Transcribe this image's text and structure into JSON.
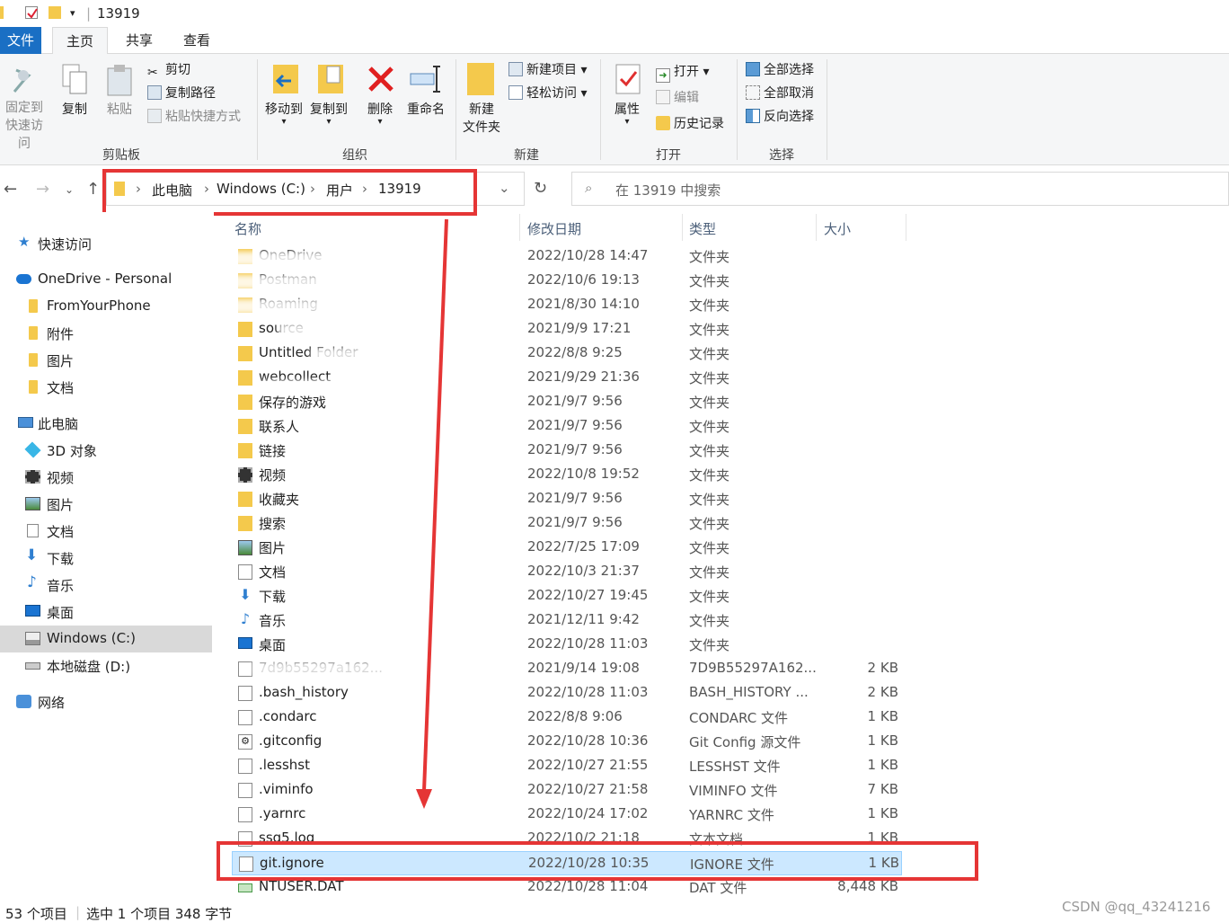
{
  "window": {
    "title": "13919"
  },
  "ribbon_tabs": [
    "文件",
    "主页",
    "共享",
    "查看"
  ],
  "ribbon": {
    "clipboard": {
      "label": "剪贴板",
      "pin": "固定到",
      "pin2": "快速访问",
      "copy": "复制",
      "paste": "粘贴",
      "cut": "剪切",
      "copy_path": "复制路径",
      "paste_shortcut": "粘贴快捷方式"
    },
    "organize": {
      "label": "组织",
      "move_to": "移动到",
      "copy_to": "复制到",
      "delete": "删除",
      "rename": "重命名"
    },
    "new": {
      "label": "新建",
      "new_folder": "新建",
      "new_folder2": "文件夹",
      "new_item": "新建项目",
      "easy_access": "轻松访问"
    },
    "open": {
      "label": "打开",
      "properties": "属性",
      "open": "打开",
      "edit": "编辑",
      "history": "历史记录"
    },
    "select": {
      "label": "选择",
      "select_all": "全部选择",
      "select_none": "全部取消",
      "invert": "反向选择"
    }
  },
  "address": {
    "crumbs": [
      "此电脑",
      "Windows (C:)",
      "用户",
      "13919"
    ],
    "search_placeholder": "在 13919 中搜索"
  },
  "sidebar": [
    {
      "label": "快速访问",
      "icon": "star-icon"
    },
    {
      "label": "OneDrive - Personal",
      "icon": "cloud-icon"
    },
    {
      "label": "FromYourPhone",
      "icon": "folder-icon"
    },
    {
      "label": "附件",
      "icon": "folder-icon"
    },
    {
      "label": "图片",
      "icon": "folder-icon"
    },
    {
      "label": "文档",
      "icon": "folder-icon"
    },
    {
      "label": "此电脑",
      "icon": "computer-icon"
    },
    {
      "label": "3D 对象",
      "icon": "cube-icon"
    },
    {
      "label": "视频",
      "icon": "film-icon"
    },
    {
      "label": "图片",
      "icon": "picture-icon"
    },
    {
      "label": "文档",
      "icon": "document-icon"
    },
    {
      "label": "下载",
      "icon": "download-icon"
    },
    {
      "label": "音乐",
      "icon": "music-icon"
    },
    {
      "label": "桌面",
      "icon": "desktop-icon"
    },
    {
      "label": "Windows (C:)",
      "icon": "drive-icon"
    },
    {
      "label": "本地磁盘 (D:)",
      "icon": "disk-icon"
    },
    {
      "label": "网络",
      "icon": "network-icon"
    }
  ],
  "columns": [
    "名称",
    "修改日期",
    "类型",
    "大小"
  ],
  "files": [
    {
      "name": "OneDrive",
      "date": "2022/10/28 14:47",
      "type": "文件夹",
      "size": "",
      "icon": "folder"
    },
    {
      "name": "Postman",
      "date": "2022/10/6 19:13",
      "type": "文件夹",
      "size": "",
      "icon": "folder"
    },
    {
      "name": "Roaming",
      "date": "2021/8/30 14:10",
      "type": "文件夹",
      "size": "",
      "icon": "folder"
    },
    {
      "name": "source",
      "date": "2021/9/9 17:21",
      "type": "文件夹",
      "size": "",
      "icon": "folder"
    },
    {
      "name": "Untitled Folder",
      "date": "2022/8/8 9:25",
      "type": "文件夹",
      "size": "",
      "icon": "folder"
    },
    {
      "name": "webcollect",
      "date": "2021/9/29 21:36",
      "type": "文件夹",
      "size": "",
      "icon": "folder"
    },
    {
      "name": "保存的游戏",
      "date": "2021/9/7 9:56",
      "type": "文件夹",
      "size": "",
      "icon": "folder"
    },
    {
      "name": "联系人",
      "date": "2021/9/7 9:56",
      "type": "文件夹",
      "size": "",
      "icon": "folder"
    },
    {
      "name": "链接",
      "date": "2021/9/7 9:56",
      "type": "文件夹",
      "size": "",
      "icon": "folder"
    },
    {
      "name": "视频",
      "date": "2022/10/8 19:52",
      "type": "文件夹",
      "size": "",
      "icon": "film"
    },
    {
      "name": "收藏夹",
      "date": "2021/9/7 9:56",
      "type": "文件夹",
      "size": "",
      "icon": "folder"
    },
    {
      "name": "搜索",
      "date": "2021/9/7 9:56",
      "type": "文件夹",
      "size": "",
      "icon": "folder"
    },
    {
      "name": "图片",
      "date": "2022/7/25 17:09",
      "type": "文件夹",
      "size": "",
      "icon": "picture"
    },
    {
      "name": "文档",
      "date": "2022/10/3 21:37",
      "type": "文件夹",
      "size": "",
      "icon": "document"
    },
    {
      "name": "下载",
      "date": "2022/10/27 19:45",
      "type": "文件夹",
      "size": "",
      "icon": "download"
    },
    {
      "name": "音乐",
      "date": "2021/12/11 9:42",
      "type": "文件夹",
      "size": "",
      "icon": "music"
    },
    {
      "name": "桌面",
      "date": "2022/10/28 11:03",
      "type": "文件夹",
      "size": "",
      "icon": "desktop"
    },
    {
      "name": "7d9b55297a162...",
      "date": "2021/9/14 19:08",
      "type": "7D9B55297A162...",
      "size": "2 KB",
      "icon": "doc"
    },
    {
      "name": ".bash_history",
      "date": "2022/10/28 11:03",
      "type": "BASH_HISTORY ...",
      "size": "2 KB",
      "icon": "doc"
    },
    {
      "name": ".condarc",
      "date": "2022/8/8 9:06",
      "type": "CONDARC 文件",
      "size": "1 KB",
      "icon": "doc"
    },
    {
      "name": ".gitconfig",
      "date": "2022/10/28 10:36",
      "type": "Git Config 源文件",
      "size": "1 KB",
      "icon": "gear-doc"
    },
    {
      "name": ".lesshst",
      "date": "2022/10/27 21:55",
      "type": "LESSHST 文件",
      "size": "1 KB",
      "icon": "doc"
    },
    {
      "name": ".viminfo",
      "date": "2022/10/27 21:58",
      "type": "VIMINFO 文件",
      "size": "7 KB",
      "icon": "doc"
    },
    {
      "name": ".yarnrc",
      "date": "2022/10/24 17:02",
      "type": "YARNRC 文件",
      "size": "1 KB",
      "icon": "doc"
    },
    {
      "name": "ssq5.log",
      "date": "2022/10/2 21:18",
      "type": "文本文档",
      "size": "1 KB",
      "icon": "text"
    },
    {
      "name": "git.ignore",
      "date": "2022/10/28 10:35",
      "type": "IGNORE 文件",
      "size": "1 KB",
      "icon": "doc",
      "selected": true
    },
    {
      "name": "NTUSER.DAT",
      "date": "2022/10/28 11:04",
      "type": "DAT 文件",
      "size": "8,448 KB",
      "icon": "dat"
    }
  ],
  "status": {
    "count": "53 个项目",
    "selection": "选中 1 个项目  348 字节"
  },
  "watermark": "CSDN @qq_43241216",
  "colors": {
    "accent": "#1a6fc4",
    "annotation": "#e53535",
    "selected_row": "#cce8ff"
  }
}
